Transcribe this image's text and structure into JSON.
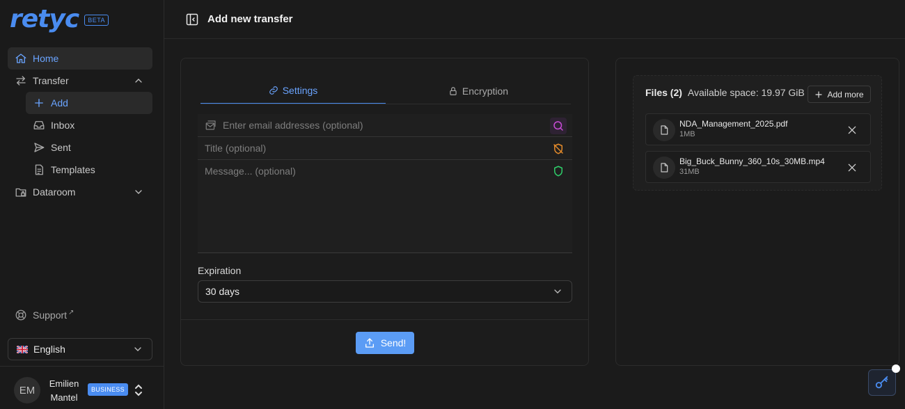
{
  "brand": {
    "logo": "retyc",
    "badge": "BETA"
  },
  "sidebar": {
    "items": [
      {
        "label": "Home",
        "icon": "home-icon"
      },
      {
        "label": "Transfer",
        "icon": "arrows-transfer-icon"
      },
      {
        "label": "Add",
        "icon": "plus-icon"
      },
      {
        "label": "Inbox",
        "icon": "inbox-icon"
      },
      {
        "label": "Sent",
        "icon": "send-icon"
      },
      {
        "label": "Templates",
        "icon": "document-icon"
      },
      {
        "label": "Dataroom",
        "icon": "folder-lock-icon"
      }
    ],
    "support": "Support",
    "language": "English",
    "user": {
      "initials": "EM",
      "name": "Emilien Mantel",
      "plan": "BUSINESS"
    }
  },
  "header": {
    "title": "Add new transfer"
  },
  "tabs": [
    {
      "label": "Settings",
      "icon": "link-icon"
    },
    {
      "label": "Encryption",
      "icon": "lock-icon"
    }
  ],
  "form": {
    "email_placeholder": "Enter email addresses (optional)",
    "title_placeholder": "Title (optional)",
    "message_placeholder": "Message... (optional)",
    "expiration_label": "Expiration",
    "expiration_value": "30 days",
    "send_label": "Send!"
  },
  "files": {
    "heading": "Files (2)",
    "available": "Available space: 19.97 GiB",
    "add_more": "Add more",
    "list": [
      {
        "name": "NDA_Management_2025.pdf",
        "size": "1MB"
      },
      {
        "name": "Big_Buck_Bunny_360_10s_30MB.mp4",
        "size": "31MB"
      }
    ]
  },
  "colors": {
    "accent": "#4a8cf0",
    "warning": "#e38a2a",
    "success": "#2fcf6a",
    "search": "#c84bd6"
  }
}
